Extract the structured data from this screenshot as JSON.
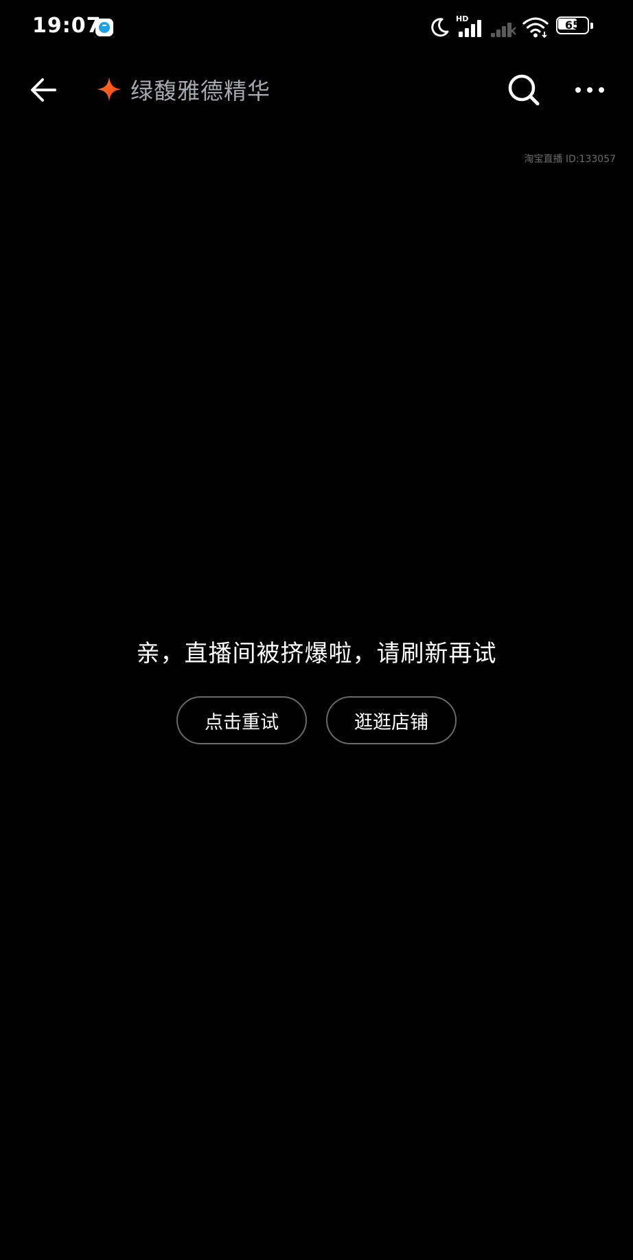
{
  "status_bar": {
    "time": "19:07",
    "network_label": "HD",
    "battery_level": "65",
    "battery_percent": 65
  },
  "header": {
    "title": "绿馥雅德精华",
    "icons": {
      "back": "back-arrow-icon",
      "brand": "sparkle-icon",
      "search": "search-icon",
      "more": "more-horizontal-icon"
    },
    "brand_color": "#ff5a1f"
  },
  "live": {
    "id_text": "淘宝直播 ID:133057"
  },
  "error": {
    "message": "亲，直播间被挤爆啦，请刷新再试",
    "retry_label": "点击重试",
    "shop_label": "逛逛店铺"
  }
}
